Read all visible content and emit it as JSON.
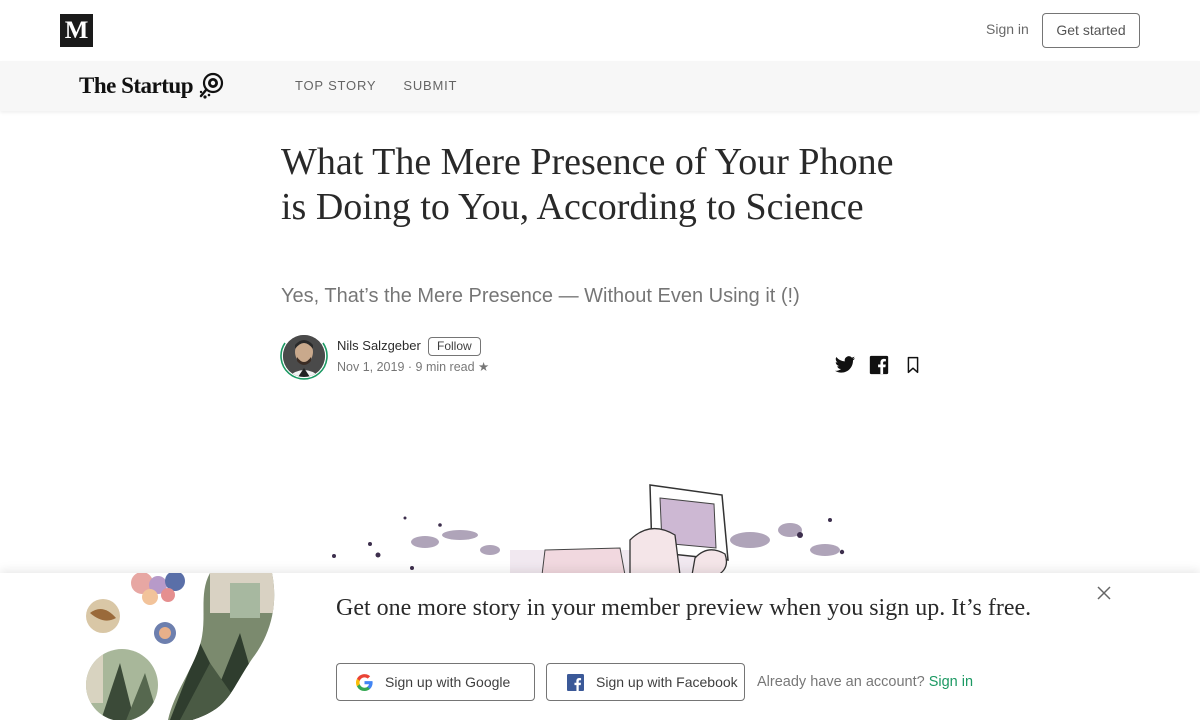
{
  "topbar": {
    "logo_letter": "M",
    "sign_in": "Sign in",
    "get_started": "Get started"
  },
  "publication": {
    "name": "The Startup",
    "nav": [
      {
        "label": "TOP STORY"
      },
      {
        "label": "SUBMIT"
      }
    ]
  },
  "article": {
    "title": "What The Mere Presence of Your Phone is Doing to You, According to Science",
    "subtitle": "Yes, That’s the Mere Presence — Without Even Using it (!)",
    "author": {
      "name": "Nils Salzgeber",
      "follow_label": "Follow",
      "meta": "Nov 1, 2019 · 9 min read ★"
    },
    "share_icons": [
      "twitter-icon",
      "facebook-icon",
      "bookmark-icon"
    ]
  },
  "banner": {
    "headline": "Get one more story in your member preview when you sign up. It’s free.",
    "google_label": "Sign up with Google",
    "facebook_label": "Sign up with Facebook",
    "already_text": "Already have an account?",
    "sign_in_link": "Sign in"
  },
  "colors": {
    "accent_green": "#1c9963",
    "pub_bar_bg": "#f7f7f7",
    "facebook_blue": "#3b5998"
  }
}
